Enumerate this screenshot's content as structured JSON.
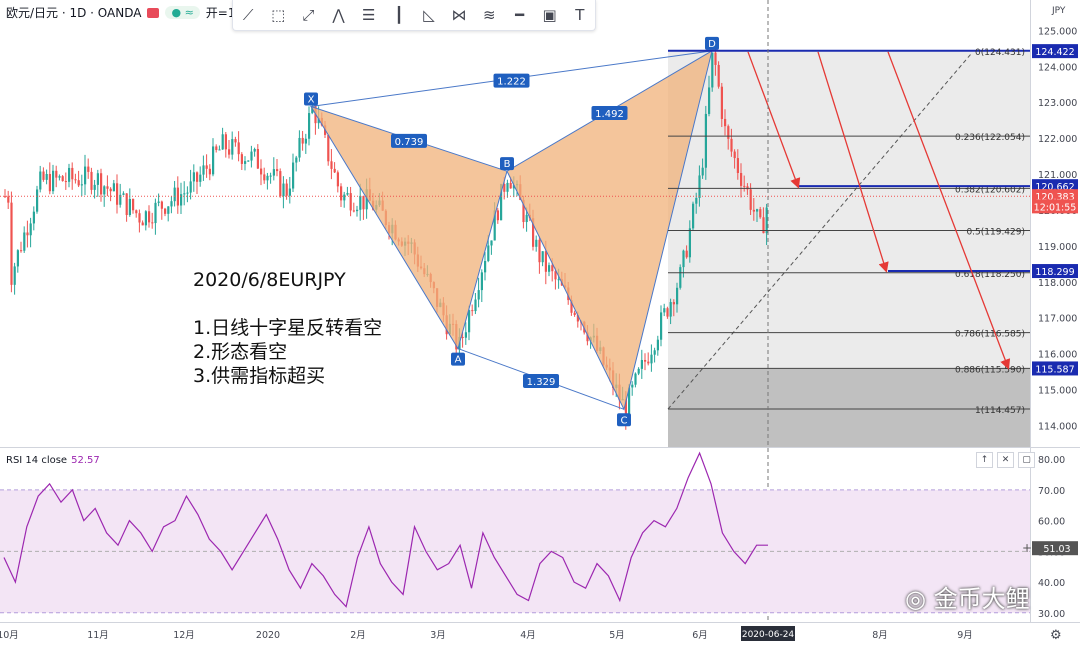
{
  "header": {
    "symbol": "欧元/日元 · 1D · OANDA",
    "status_pill": "● ≈",
    "ohlc_prefix": "开=1"
  },
  "toolbar": [
    "trend-line",
    "rectangle",
    "path",
    "elliott-wave",
    "fib-retracement",
    "vertical-line",
    "triangle",
    "xabcd-pattern",
    "fib-channel",
    "horizontal-ray",
    "frame",
    "text"
  ],
  "annotation": {
    "title": "2020/6/8EURJPY",
    "lines": [
      "1.日线十字星反转看空",
      "2.形态看空",
      "3.供需指标超买"
    ]
  },
  "watermark": "金币大鲤",
  "rsi_panel": {
    "label": "RSI 14 close",
    "value": "52.57",
    "buttons": [
      "↑",
      "✕",
      "▢"
    ]
  },
  "colors": {
    "up": "#26a69a",
    "down": "#ef5350",
    "pattern_fill": "#f0b27a",
    "pattern_line": "#4a78c8",
    "rsi_line": "#9c27b0",
    "rsi_band": "#f3e5f5",
    "label_blue": "#1f5fbf",
    "fib_zone": "#e4e4e4",
    "fib_dark": "#b0b0b0",
    "arrow": "#e53935"
  },
  "chart_data": [
    {
      "type": "candlestick",
      "title": "",
      "ylim": [
        113.4,
        125.4
      ],
      "price_axis_unit": "JPY",
      "y_ticks": [
        "125.000",
        "124.000",
        "123.000",
        "122.000",
        "121.000",
        "120.000",
        "119.000",
        "118.000",
        "117.000",
        "116.000",
        "115.000",
        "114.000"
      ],
      "price_labels": [
        {
          "text": "124.422",
          "value": 124.422,
          "style": "blue"
        },
        {
          "text": "120.662",
          "value": 120.662,
          "style": "blue"
        },
        {
          "text": "120.383",
          "value": 120.383,
          "style": "red"
        },
        {
          "text": "12:01:55",
          "value": 120.1,
          "style": "red"
        },
        {
          "text": "118.299",
          "value": 118.299,
          "style": "blue"
        },
        {
          "text": "115.587",
          "value": 115.587,
          "style": "blue"
        }
      ],
      "x_axis_labels": [
        "10月",
        "11月",
        "12月",
        "2020",
        "2月",
        "3月",
        "4月",
        "5月",
        "6月",
        "2020-06-24",
        "8月",
        "9月"
      ],
      "pattern": {
        "points": [
          {
            "name": "X",
            "value": 122.88
          },
          {
            "name": "A",
            "value": 116.14
          },
          {
            "name": "B",
            "value": 121.08
          },
          {
            "name": "C",
            "value": 114.45
          },
          {
            "name": "D",
            "value": 124.43
          }
        ],
        "ratios": [
          "0.739",
          "1.329",
          "1.492",
          "1.222"
        ]
      },
      "fibonacci": [
        {
          "label": "0(124.431)",
          "value": 124.431
        },
        {
          "label": "0.236(122.054)",
          "value": 122.054
        },
        {
          "label": "0.382(120.602)",
          "value": 120.602
        },
        {
          "label": "0.5(119.429)",
          "value": 119.429
        },
        {
          "label": "0.618(118.250)",
          "value": 118.25
        },
        {
          "label": "0.786(116.585)",
          "value": 116.585
        },
        {
          "label": "0.886(115.590)",
          "value": 115.59
        },
        {
          "label": "1(114.457)",
          "value": 114.457
        }
      ],
      "current_price": 120.383
    },
    {
      "type": "line",
      "series": [
        {
          "name": "RSI 14 close"
        }
      ],
      "ylim": [
        27,
        83
      ],
      "y_ticks": [
        "80.00",
        "70.00",
        "60.00",
        "50.00",
        "40.00",
        "30.00"
      ],
      "bands": [
        70,
        30
      ],
      "midline": 50,
      "last_value_label": "51.03",
      "keypoints": [
        48,
        40,
        58,
        68,
        72,
        66,
        70,
        60,
        64,
        56,
        52,
        60,
        56,
        50,
        58,
        60,
        68,
        62,
        54,
        50,
        44,
        50,
        56,
        62,
        54,
        44,
        38,
        46,
        42,
        36,
        32,
        48,
        58,
        46,
        40,
        36,
        58,
        50,
        44,
        46,
        52,
        38,
        56,
        48,
        42,
        36,
        34,
        46,
        50,
        48,
        40,
        38,
        46,
        42,
        34,
        48,
        56,
        60,
        58,
        64,
        74,
        82,
        72,
        56,
        50,
        46,
        52,
        52
      ]
    }
  ]
}
